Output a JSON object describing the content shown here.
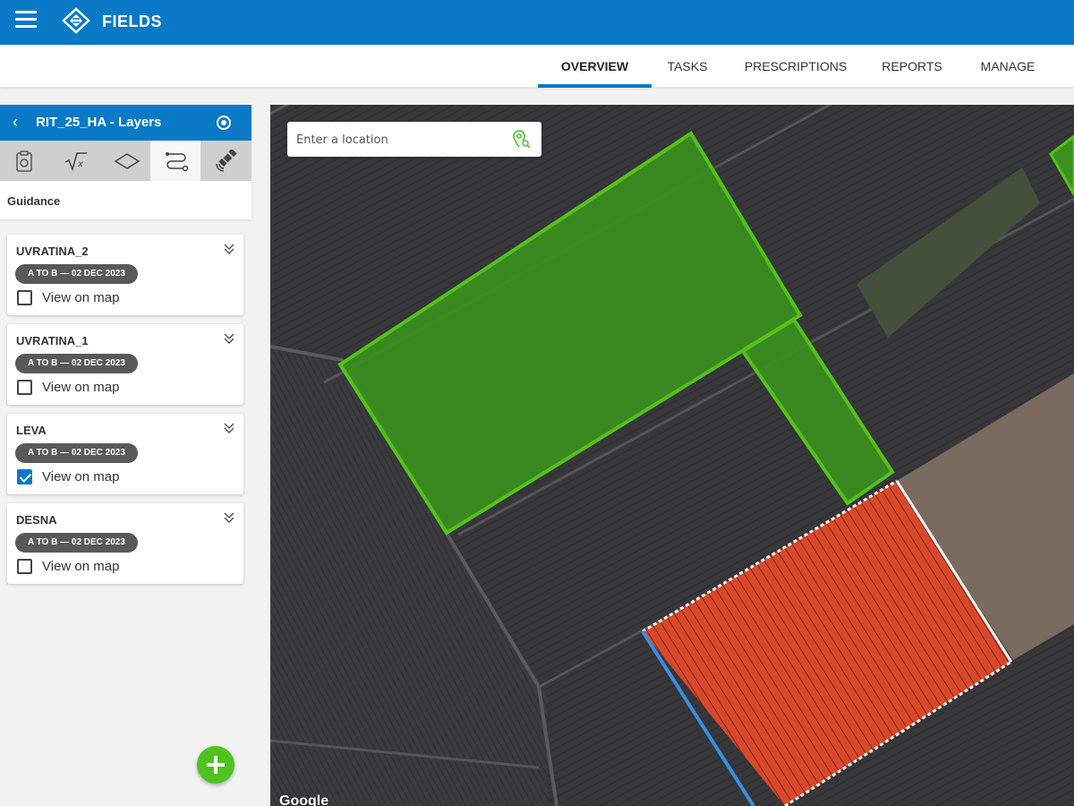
{
  "app": {
    "title": "FIELDS",
    "accent_color": "#0a79c6"
  },
  "nav": {
    "tabs": [
      {
        "label": "OVERVIEW",
        "active": true
      },
      {
        "label": "TASKS",
        "active": false
      },
      {
        "label": "PRESCRIPTIONS",
        "active": false
      },
      {
        "label": "REPORTS",
        "active": false
      },
      {
        "label": "MANAGE",
        "active": false
      }
    ]
  },
  "panel": {
    "title": "RIT_25_HA - Layers",
    "icon_tabs": [
      "clipboard-icon",
      "sqrt-icon",
      "layers-icon",
      "guidance-route-icon",
      "satellite-icon"
    ],
    "active_icon_tab": "guidance-route-icon",
    "section_label": "Guidance",
    "cards": [
      {
        "title": "UVRATINA_2",
        "pill": "A TO B — 02 DEC 2023",
        "checkbox_label": "View on map",
        "checked": false
      },
      {
        "title": "UVRATINA_1",
        "pill": "A TO B — 02 DEC 2023",
        "checkbox_label": "View on map",
        "checked": false
      },
      {
        "title": "LEVA",
        "pill": "A TO B — 02 DEC 2023",
        "checkbox_label": "View on map",
        "checked": true
      },
      {
        "title": "DESNA",
        "pill": "A TO B — 02 DEC 2023",
        "checkbox_label": "View on map",
        "checked": false
      }
    ]
  },
  "map": {
    "search_placeholder": "Enter a location",
    "attribution": "Google",
    "colors": {
      "field_green": "#3b8f1e",
      "field_outline": "#53c21a",
      "guidance_red": "#d9482b",
      "ab_line_blue": "#3a8ee0"
    }
  }
}
